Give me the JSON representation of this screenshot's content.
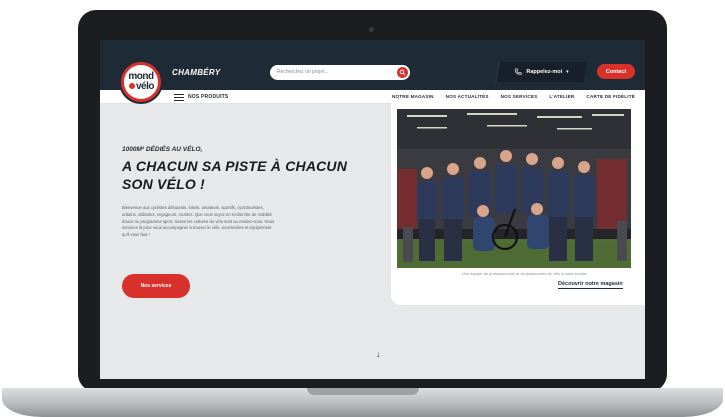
{
  "brand": {
    "logo_line1": "mond",
    "logo_line2": "vélo",
    "red": "#d8312b",
    "navy": "#1f2a37"
  },
  "header": {
    "city": "CHAMBÉRY",
    "search_placeholder": "Recherchez un projet...",
    "callback_label": "Rappelez-moi",
    "contact_label": "Contact"
  },
  "nav": {
    "menu_label": "NOS PRODUITS",
    "links": [
      "NOTRE MAGASIN",
      "NOS ACTUALITÉS",
      "NOS SERVICES",
      "L'ATELIER",
      "CARTE DE FIDÉLITÉ"
    ]
  },
  "hero": {
    "kicker": "1000M² DÉDIÉS AU VÉLO,",
    "headline_line1": "A CHACUN SA PISTE À CHACUN",
    "headline_line2": "SON VÉLO !",
    "paragraph": "Bienvenue aux cyclistes débutants, loisirs, amateurs, sportifs, cyclotouristes, urbains, utilitaires, voyageurs, routiers. Que vous soyez en recherche de mobilité douce ou programme sport, toutes les cultures du vélo sont au rendez-vous. Nous sommes là pour vous accompagner à trouver le vélo, accessoires et équipement qu'il vous faut !",
    "cta_label": "Nos services"
  },
  "photo_card": {
    "caption": "Une équipe de professionnels et de passionnés de vélo à votre écoute",
    "discover_label": "Découvrir notre magasin"
  },
  "icons": [
    "search-icon",
    "phone-icon",
    "chevron-down-icon",
    "menu-icon",
    "scroll-down-icon"
  ]
}
